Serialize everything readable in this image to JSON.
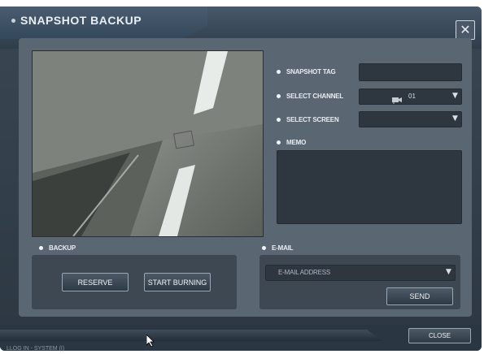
{
  "window": {
    "title": "SNAPSHOT BACKUP",
    "close_icon": "✕"
  },
  "form": {
    "snapshot_tag_label": "SNAPSHOT TAG",
    "snapshot_tag_value": "",
    "select_channel_label": "SELECT CHANNEL",
    "select_channel_value": "01",
    "select_screen_label": "SELECT SCREEN",
    "select_screen_value": "",
    "memo_label": "MEMO",
    "memo_value": ""
  },
  "backup": {
    "label": "BACKUP",
    "reserve_label": "RESERVE",
    "start_burning_label": "START BURNING"
  },
  "email": {
    "label": "E-MAIL",
    "address_label": "E-MAIL ADDRESS",
    "address_value": "",
    "send_label": "SEND"
  },
  "footer": {
    "close_label": "CLOSE",
    "status_text": "LLOG IN - SYSTEM (I)"
  },
  "icons": {
    "dropdown": "▼",
    "channel": "camera-flag-icon"
  }
}
